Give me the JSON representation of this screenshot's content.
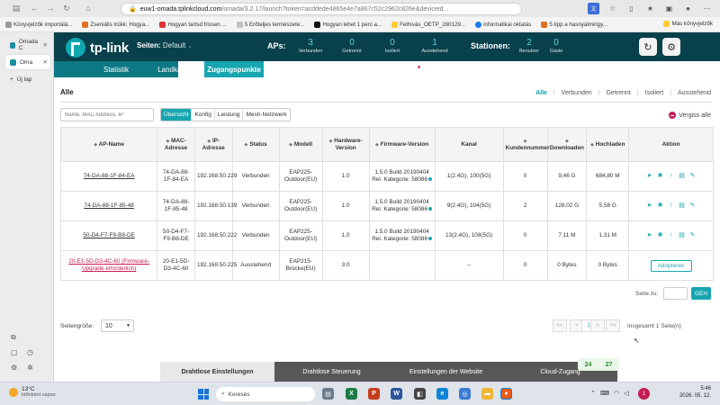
{
  "browser": {
    "url_host": "euw1-omada.tplinkcloud.com",
    "url_rest": "/omada/3.2.17/launch?token=acddede4865e4e7a867c52c2962c826e&deviceId...",
    "bookmarks": [
      "Könyvjelzők importálá...",
      "Zseniális trükk: Hogya...",
      "Hogyan tartsd frissen ...",
      "5 Erőteljes természete...",
      "Hogyan lehet 1 perc a...",
      "Felhívás_OETP_260129...",
      "informatikai oktatás",
      "5 tipp a hasnyálmirigy..."
    ],
    "other_bookmarks": "Más könyvjelzők",
    "sidebar_tabs": [
      "Omada C",
      "Oma"
    ],
    "new_tab_label": "Új lap"
  },
  "header": {
    "logo": "tp-link",
    "sites_label": "Seiten:",
    "sites_value": "Default",
    "aps_label": "APs:",
    "ap_stats": [
      {
        "value": "3",
        "label": "Verbunden"
      },
      {
        "value": "0",
        "label": "Getrennt"
      },
      {
        "value": "0",
        "label": "Isoliert"
      },
      {
        "value": "1",
        "label": "Ausstehend"
      }
    ],
    "stations_label": "Stationen:",
    "station_stats": [
      {
        "value": "2",
        "label": "Benutzer"
      },
      {
        "value": "0",
        "label": "Gäste"
      }
    ]
  },
  "tabs": [
    "Statistik",
    "Landkarte",
    "Zugangspunkte",
    "Kunden",
    "Einsicht",
    "Log"
  ],
  "active_tab": "Zugangspunkte",
  "content": {
    "title": "Alle",
    "filters": [
      "Alle",
      "Verbunden",
      "Getrennt",
      "Isoliert",
      "Ausstehend"
    ],
    "search_placeholder": "Name, MAC Address, IP",
    "view_tabs": [
      "Übersicht",
      "Konfig",
      "Leistung",
      "Mesh-Netzwerk"
    ],
    "forget_all": "Vergiss alle",
    "columns": [
      "AP-Name",
      "MAC-Adresse",
      "IP-Adresse",
      "Status",
      "Modell",
      "Hardware-Version",
      "Firmware-Version",
      "Kanal",
      "Kundennummer",
      "Downloaden",
      "Hochladen",
      "Aktion"
    ],
    "rows": [
      {
        "name": "74-DA-88-1F-84-EA",
        "mac": "74-DA-88-1F-84-EA",
        "ip": "192.168.50.229",
        "status": "Verbunden",
        "model": "EAP225-Outdoor(EU)",
        "hw": "1.0",
        "fw1": "1.5.0 Build 20190404",
        "fw2": "Rel. Kategorie: 58086",
        "channel": "1(2.4G), 100(5G)",
        "clients": "0",
        "down": "9,46 G",
        "up": "684,80 M"
      },
      {
        "name": "74-DA-88-1F-85-48",
        "mac": "74-DA-88-1F-85-48",
        "ip": "192.168.50.139",
        "status": "Verbunden",
        "model": "EAP225-Outdoor(EU)",
        "hw": "1.0",
        "fw1": "1.5.0 Build 20190404",
        "fw2": "Rel. Kategorie: 58086",
        "channel": "9(2.4G), 104(5G)",
        "clients": "2",
        "down": "128,02 G",
        "up": "5,58 G"
      },
      {
        "name": "50-D4-F7-F9-B8-DE",
        "mac": "50-D4-F7-F9-B8-DE",
        "ip": "192.168.50.222",
        "status": "Verbunden",
        "model": "EAP225-Outdoor(EU)",
        "hw": "1.0",
        "fw1": "1.5.0 Build 20190404",
        "fw2": "Rel. Kategorie: 58086",
        "channel": "13(2.4G), 108(5G)",
        "clients": "0",
        "down": "7,11 M",
        "up": "1,31 M"
      },
      {
        "name": "20-E1-5D-D3-4C-60 (Firmware-Upgrade erforderlich)",
        "mac": "20-E1-5D-D3-4C-60",
        "ip": "192.168.50.225",
        "status": "Ausstehend",
        "model": "EAP215-Brücke(EU)",
        "hw": "3.0",
        "fw1": "",
        "fw2": "",
        "channel": "--",
        "clients": "0",
        "down": "0 Bytes",
        "up": "0 Bytes"
      }
    ],
    "adopt_label": "Adopteren",
    "page_size_label": "Seitengröße:",
    "page_size": "10",
    "pager": [
      "<<",
      "<",
      "1",
      ">",
      ">>"
    ],
    "total": "Insgesamt 1 Seite(n)",
    "goto_label": "Seite zu:",
    "go_label": "GEH"
  },
  "bottom_tabs": [
    "Drahtlose Einstellungen",
    "Drahtlose Steuerung",
    "Einstellungen der Website",
    "Cloud-Zugang"
  ],
  "counter": [
    "24",
    "27"
  ],
  "taskbar": {
    "temp": "13°C",
    "weather": "Időnként napos",
    "search": "Keresés",
    "time": "5:46",
    "date": "2026. 05. 12.",
    "notif": "1"
  },
  "colors": {
    "header_bg": "#08404b",
    "tabs_bg": "#0c7985",
    "accent": "#17a6b0",
    "warning": "#c41c52",
    "ok": "#3ba33d"
  }
}
